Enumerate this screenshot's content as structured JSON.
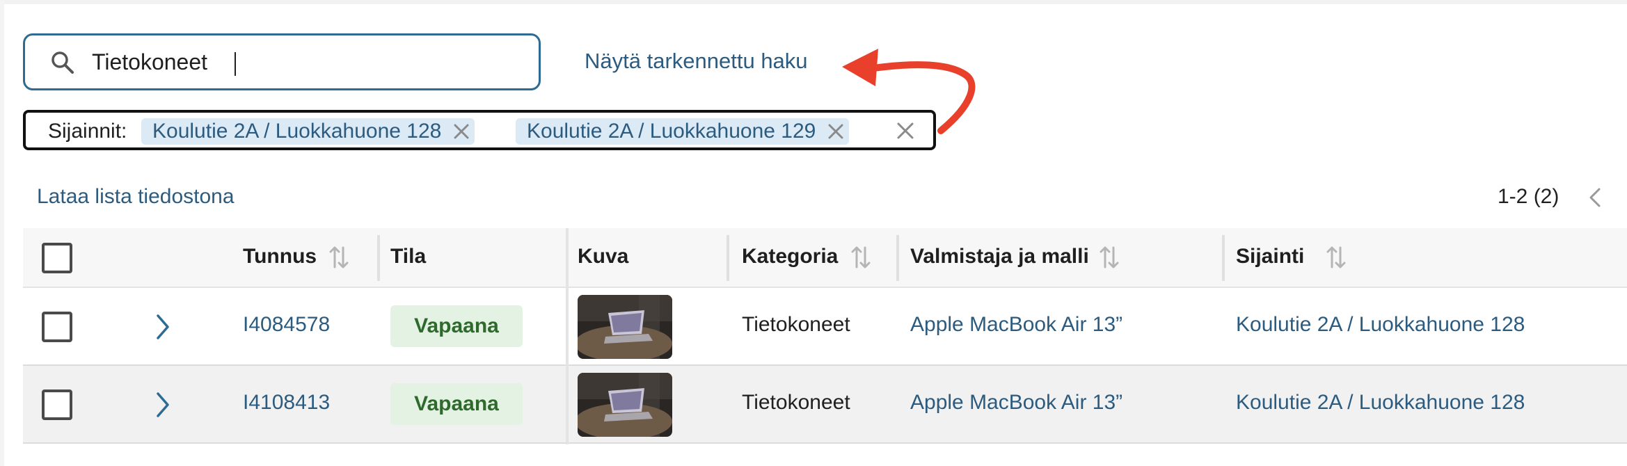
{
  "search": {
    "value": "Tietokoneet",
    "icon": "search-icon"
  },
  "advanced_search_link": "Näytä tarkennettu haku",
  "annotation": {
    "arrow_color": "#e8402b"
  },
  "filters": {
    "label": "Sijainnit:",
    "chips": [
      {
        "label": "Koulutie 2A / Luokkahuone 128"
      },
      {
        "label": "Koulutie 2A / Luokkahuone 129"
      }
    ]
  },
  "toolbar": {
    "download_label": "Lataa lista tiedostona",
    "pagination_text": "1-2 (2)"
  },
  "table": {
    "columns": [
      "Tunnus",
      "Tila",
      "Kuva",
      "Kategoria",
      "Valmistaja ja malli",
      "Sijainti"
    ],
    "rows": [
      {
        "id": "I4084578",
        "status": "Vapaana",
        "image": "laptop-photo",
        "category": "Tietokoneet",
        "model": "Apple MacBook Air 13”",
        "location": "Koulutie 2A / Luokkahuone 128"
      },
      {
        "id": "I4108413",
        "status": "Vapaana",
        "image": "laptop-photo",
        "category": "Tietokoneet",
        "model": "Apple MacBook Air 13”",
        "location": "Koulutie 2A / Luokkahuone 128"
      }
    ]
  },
  "colors": {
    "link": "#2c5b80",
    "search_border": "#2f6a93",
    "chip_bg": "#dceaf6",
    "status_bg": "#e3f2e2",
    "status_text": "#2e6a2c"
  }
}
